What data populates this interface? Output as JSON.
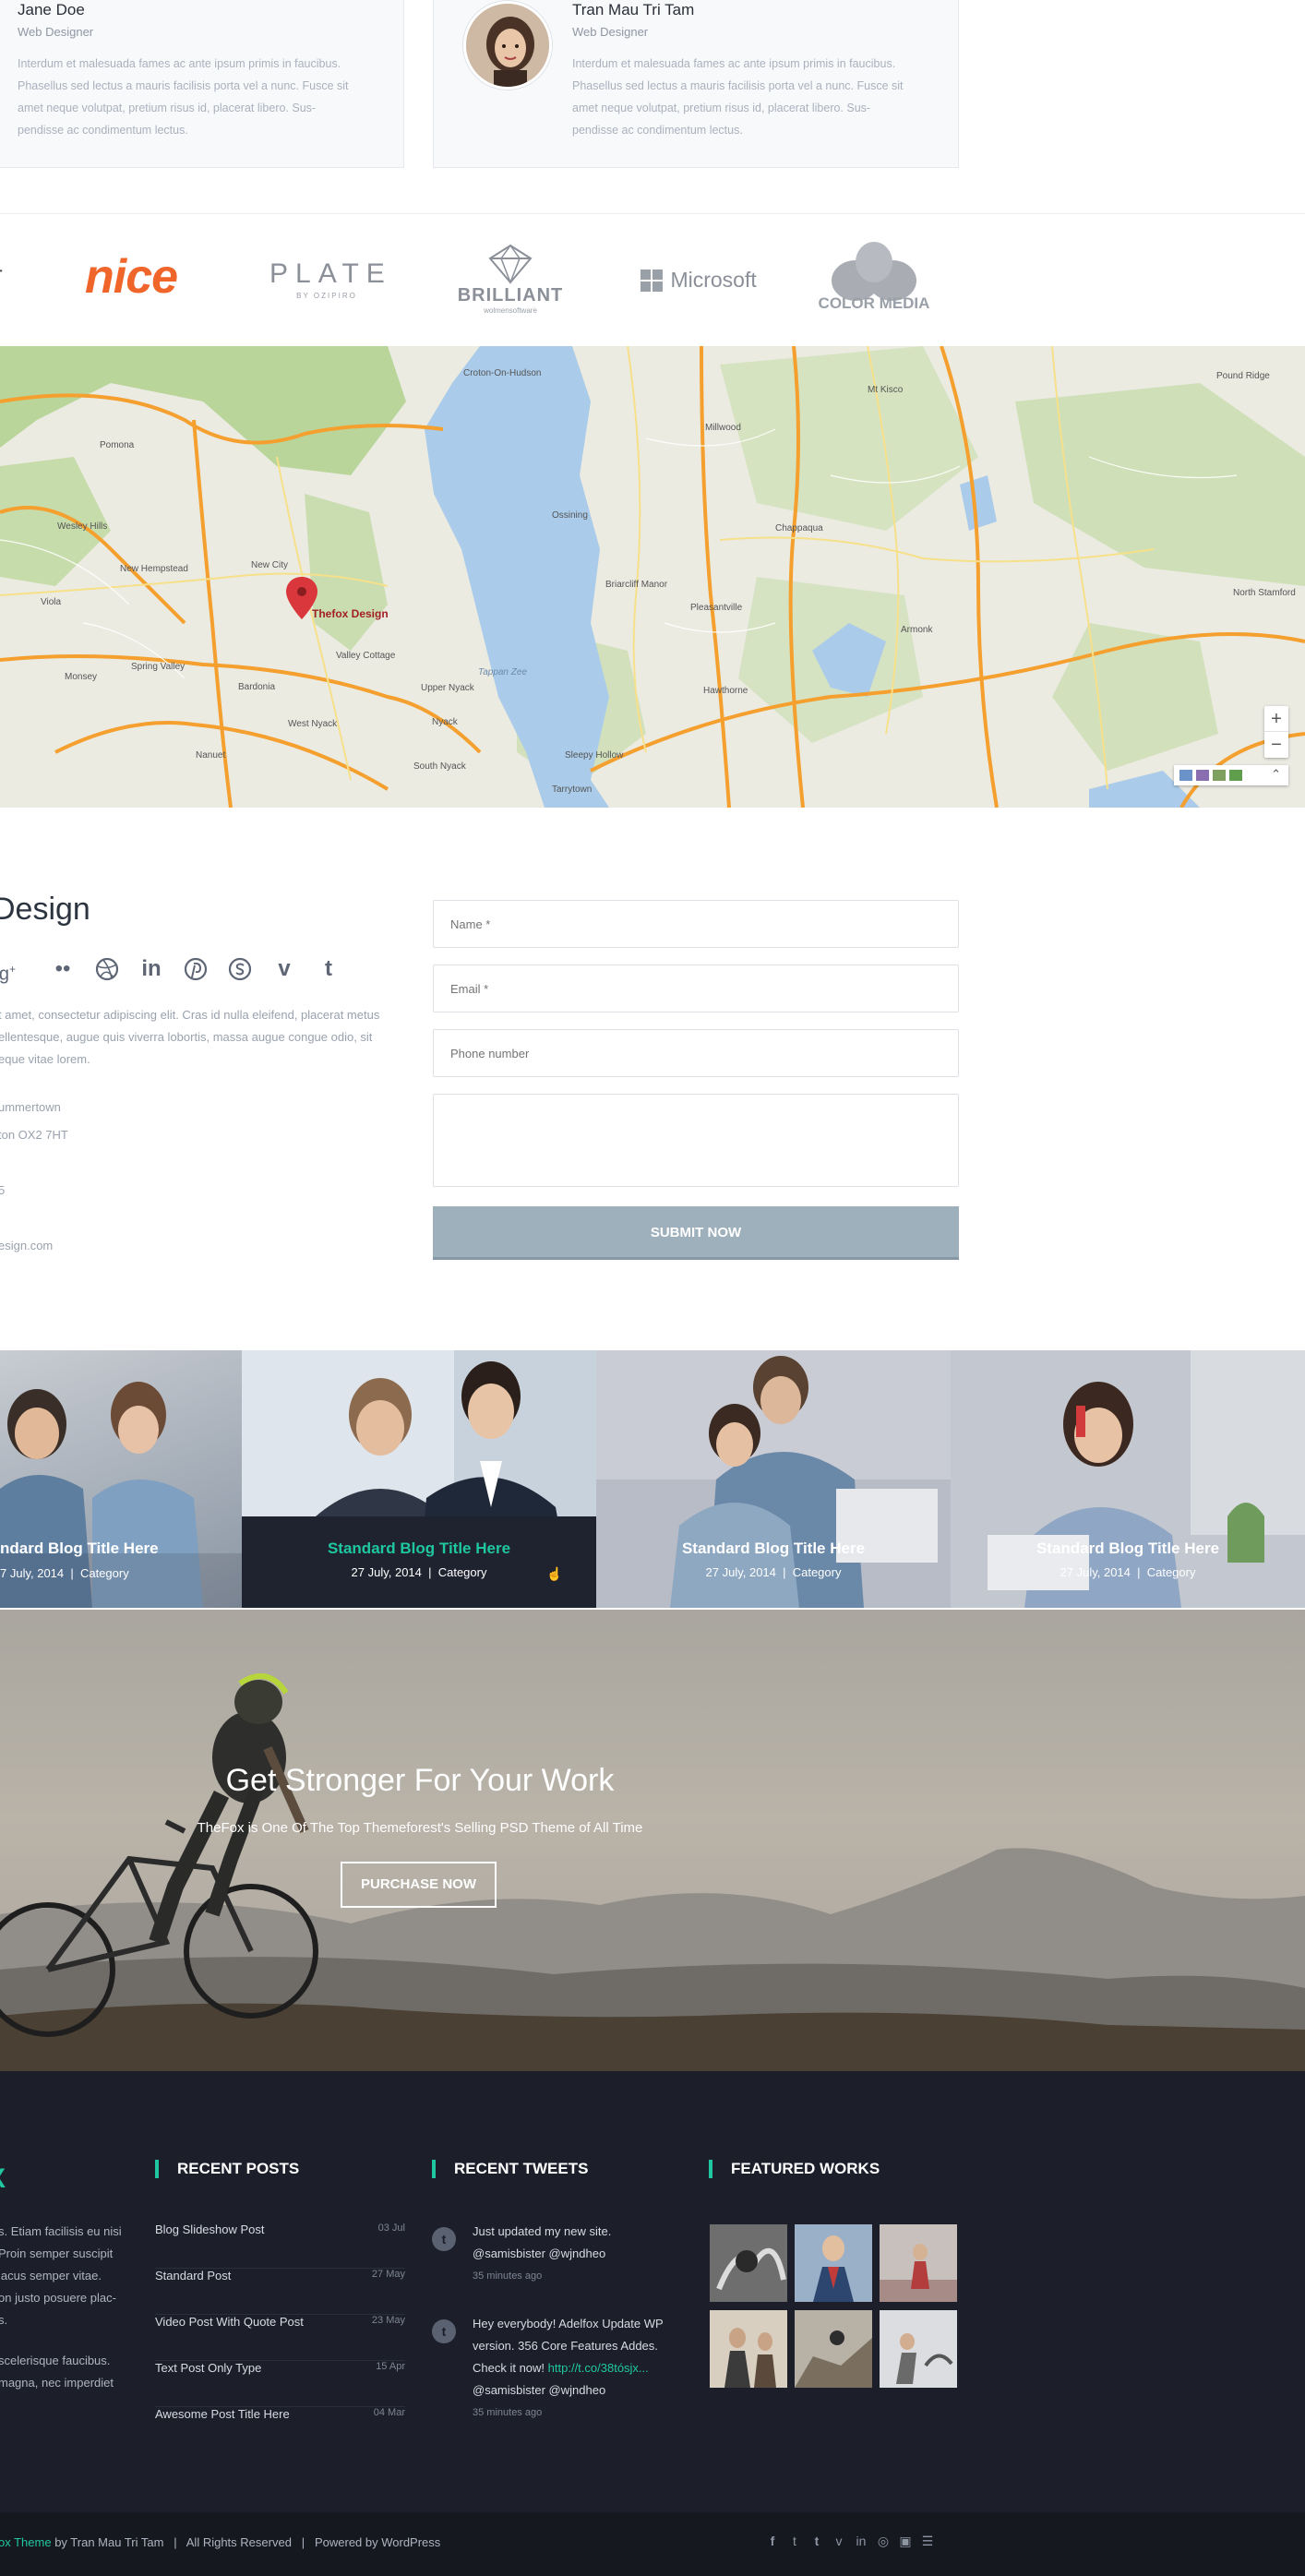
{
  "testimonials": [
    {
      "name": "Jane Doe",
      "role": "Web Designer",
      "text": [
        "Interdum et malesuada fames ac ante ipsum primis in faucibus.",
        "Phasellus sed lectus a mauris facilisis porta vel a nunc. Fusce sit",
        "amet neque volutpat, pretium risus id, placerat libero. Sus-",
        "pendisse ac condimentum lectus."
      ]
    },
    {
      "name": "Tran Mau Tri Tam",
      "role": "Web Designer",
      "text": [
        "Interdum et malesuada fames ac ante ipsum primis in faucibus.",
        "Phasellus sed lectus a mauris facilisis porta vel a nunc. Fusce sit",
        "amet neque volutpat, pretium risus id, placerat libero. Sus-",
        "pendisse ac condimentum lectus."
      ]
    }
  ],
  "logos": {
    "nice": "nice",
    "plate": "PLATE",
    "plate_sub": "BY OZIPIRO",
    "brilliant": "BRILLIANT",
    "brilliant_sub": "wolmensoftware",
    "microsoft": "Microsoft",
    "colormedia": "COLOR MEDIA"
  },
  "map": {
    "marker_label": "Thefox Design",
    "places": [
      "Croton-On-Hudson",
      "Mt Kisco",
      "Pound Ridge",
      "Pomona",
      "New City",
      "Ossining",
      "Chappaqua",
      "Millwood",
      "Briarcliff Manor",
      "Pleasantville",
      "Valley Cottage",
      "Upper Nyack",
      "Nyack",
      "South Nyack",
      "Tarrytown",
      "Armonk",
      "Spring Valley",
      "Monsey",
      "Nanuet",
      "West Nyack",
      "Wesley Hills",
      "New Hempstead",
      "Viola",
      "Hawthorne",
      "North Stamford",
      "Sleepy Hollow",
      "Tappan Zee",
      "Bardonia"
    ],
    "zoom_in": "+",
    "zoom_out": "−"
  },
  "contact": {
    "title": "Design",
    "desc": [
      "t amet, consectetur adipiscing elit. Cras id nulla eleifend, placerat metus",
      "ellentesque, augue quis viverra lobortis, massa augue congue odio, sit",
      "eque vitae lorem."
    ],
    "address1": "ummertown",
    "address2": "ton OX2 7HT",
    "phone": "5",
    "email": "esign.com",
    "name_placeholder": "Name *",
    "email_placeholder": "Email *",
    "phone_placeholder": "Phone number",
    "submit": "SUBMIT NOW"
  },
  "blog": [
    {
      "title": "ndard Blog Title Here",
      "meta": "7 July, 2014  |  Category"
    },
    {
      "title": "Standard Blog Title Here",
      "meta": "27 July, 2014  |  Category"
    },
    {
      "title": "Standard Blog Title Here",
      "meta": "27 July, 2014  |  Category"
    },
    {
      "title": "Standard Blog Title Here",
      "meta": "27 July, 2014  |  Category"
    }
  ],
  "hero": {
    "title": "Get Stronger For Your Work",
    "subtitle": "TheFox is One Of The Top Themeforest's  Selling PSD Theme of All Time",
    "button": "PURCHASE NOW"
  },
  "footer": {
    "col1_head": "X",
    "col1_text": [
      "s. Etiam facilisis eu nisi",
      "Proin semper suscipit",
      "lacus semper vitae.",
      "on justo posuere plac-",
      "s.",
      "",
      "scelerisque faucibus.",
      "magna, nec imperdiet"
    ],
    "recent_posts_head": "RECENT POSTS",
    "posts": [
      {
        "title": "Blog Slideshow Post",
        "date": "03 Jul"
      },
      {
        "title": "Standard Post",
        "date": "27 May"
      },
      {
        "title": "Video Post With Quote Post",
        "date": "23 May"
      },
      {
        "title": "Text Post Only Type",
        "date": "15 Apr"
      },
      {
        "title": "Awesome Post Title Here",
        "date": "04 Mar"
      }
    ],
    "recent_tweets_head": "RECENT TWEETS",
    "tweets": [
      {
        "line1": "Just updated my new site.",
        "line2": "@samisbister @wjndheo",
        "line3": "",
        "link": "",
        "ago": "35 minutes ago"
      },
      {
        "line1": "Hey everybody! Adelfox Update WP",
        "line2": "version. 356 Core Features Addes.",
        "line3": "Check it now! ",
        "link": "http://t.co/38tósjx...",
        "line4": "@samisbister @wjndheo",
        "ago": "35 minutes ago"
      }
    ],
    "featured_head": "FEATURED WORKS",
    "copyright_pre": "ox Theme",
    "copyright_post": " by Tran Mau Tri Tam   |   All Rights Reserved   |   Powered by WordPress",
    "social": [
      "f",
      "t",
      "t",
      "v",
      "in",
      "◎",
      "▣",
      "☰"
    ]
  }
}
